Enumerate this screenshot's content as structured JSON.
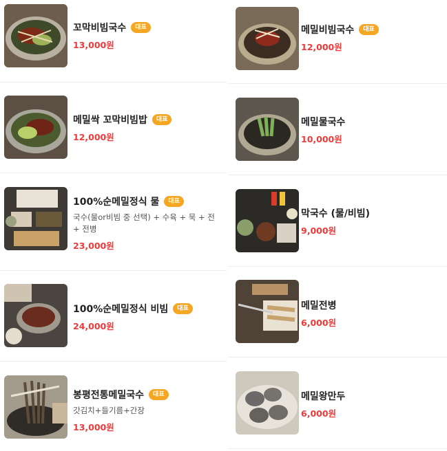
{
  "badge_label": "대표",
  "left": [
    {
      "name": "꼬막비빔국수",
      "price": "13,000원",
      "badge": true,
      "desc": ""
    },
    {
      "name": "메밀싹 꼬막비빔밥",
      "price": "12,000원",
      "badge": true,
      "desc": ""
    },
    {
      "name": "100%순메밀정식 물",
      "price": "23,000원",
      "badge": true,
      "desc": "국수(물or비빔 중 선택) + 수육 + 묵 + 전 + 전병"
    },
    {
      "name": "100%순메밀정식 비빔",
      "price": "24,000원",
      "badge": true,
      "desc": ""
    },
    {
      "name": "봉평전통메밀국수",
      "price": "13,000원",
      "badge": true,
      "desc": "갓김치+들기름+간장"
    }
  ],
  "right": [
    {
      "name": "메밀비빔국수",
      "price": "12,000원",
      "badge": true,
      "desc": ""
    },
    {
      "name": "메밀물국수",
      "price": "10,000원",
      "badge": false,
      "desc": ""
    },
    {
      "name": "막국수 (물/비빔)",
      "price": "9,000원",
      "badge": false,
      "desc": ""
    },
    {
      "name": "메밀전병",
      "price": "6,000원",
      "badge": false,
      "desc": ""
    },
    {
      "name": "메밀왕만두",
      "price": "6,000원",
      "badge": false,
      "desc": ""
    }
  ]
}
